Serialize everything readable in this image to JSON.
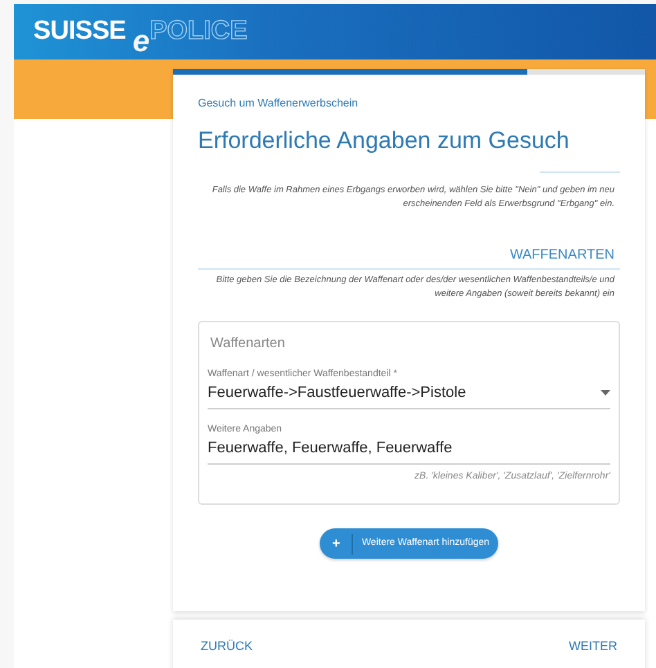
{
  "logo": {
    "brand": "SUISSE",
    "letter": "e",
    "product": "POLICE"
  },
  "progress": {
    "level": 0.75
  },
  "form": {
    "subtitle": "Gesuch um Waffenerwerbschein",
    "title": "Erforderliche Angaben zum Gesuch",
    "inheritance_note": "Falls die Waffe im Rahmen eines Erbgangs erworben wird, wählen Sie bitte \"Nein\" und geben im neu erscheinenden Feld als Erwerbsgrund \"Erbgang\" ein.",
    "section": {
      "heading": "WAFFENARTEN",
      "note": "Bitte geben Sie die Bezeichnung der Waffenart oder des/der wesentlichen Waffenbestandteils/e und weitere Angaben (soweit bereits bekannt) ein"
    },
    "group": {
      "legend": "Waffenarten",
      "fields": [
        {
          "kind": "select",
          "label": "Waffenart / wesentlicher Waffenbestandteil *",
          "value": "Feuerwaffe->Faustfeuerwaffe->Pistole"
        },
        {
          "kind": "text",
          "label": "Weitere Angaben",
          "value": "Feuerwaffe, Feuerwaffe, Feuerwaffe",
          "hint": "zB. 'kleines Kaliber', 'Zusatzlauf', 'Zielfernrohr'"
        }
      ]
    },
    "add_button": {
      "icon": "+",
      "label": "Weitere Waffenart hinzufügen"
    }
  },
  "footer": {
    "back": "ZURÜCK",
    "next": "WEITER"
  }
}
